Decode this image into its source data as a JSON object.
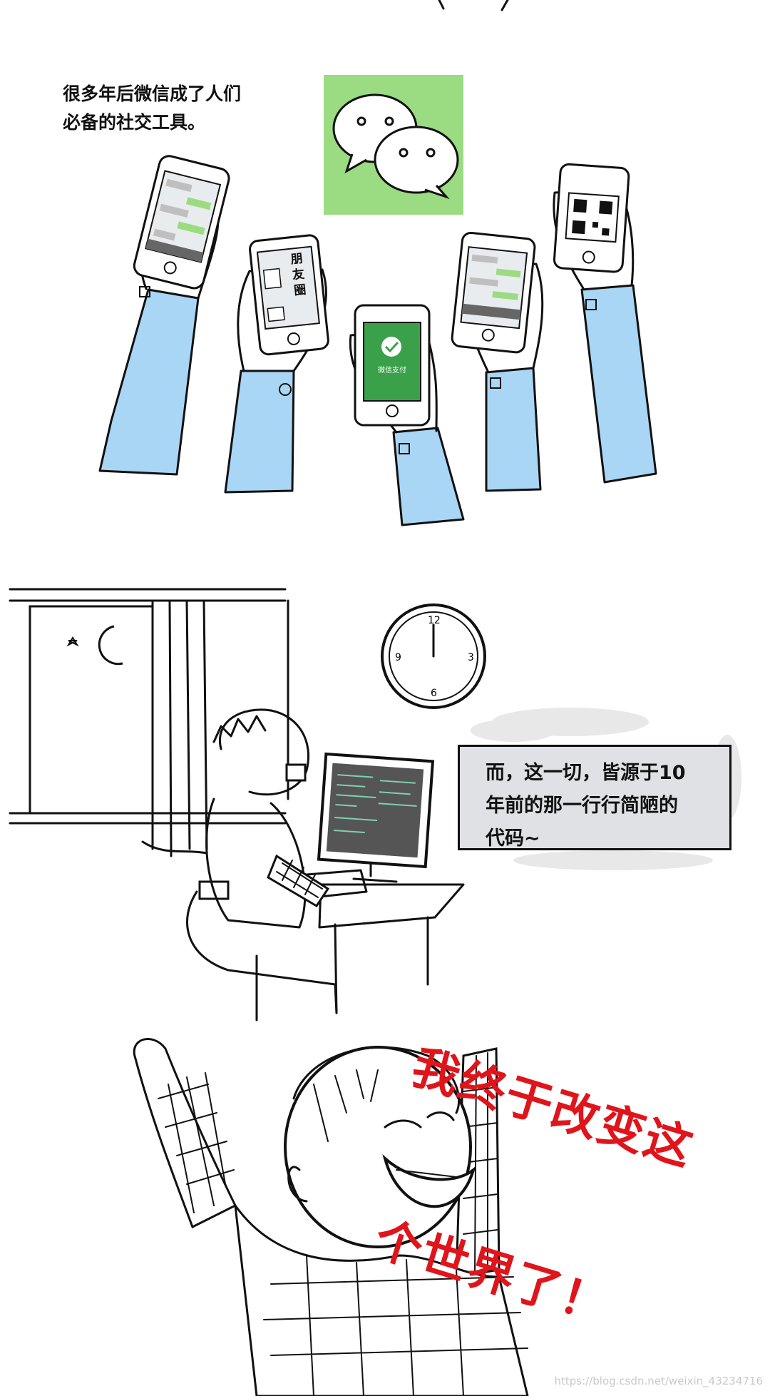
{
  "panel1": {
    "caption_lines": [
      "很多年后微信成了人们",
      "必备的社交工具。"
    ],
    "phone_labels": {
      "moments": [
        "朋",
        "友",
        "圈"
      ],
      "pay": "微信支付"
    },
    "colors": {
      "wechat_green": "#9bdc82",
      "sleeve_blue": "#a9d6f5",
      "pay_green": "#3aa14a"
    }
  },
  "panel2": {
    "caption_lines": [
      "而，这一切，皆源于10",
      "年前的那一行行简陋的",
      "代码~"
    ],
    "clock_numbers": [
      "12",
      "3",
      "6",
      "9"
    ],
    "colors": {
      "caption_box": "#dfe1e4"
    }
  },
  "panel3": {
    "shout_lines": [
      "我终于改变这",
      "个世界了！"
    ],
    "colors": {
      "shout": "#e0141b"
    }
  },
  "watermark": "https://blog.csdn.net/weixin_43234716"
}
